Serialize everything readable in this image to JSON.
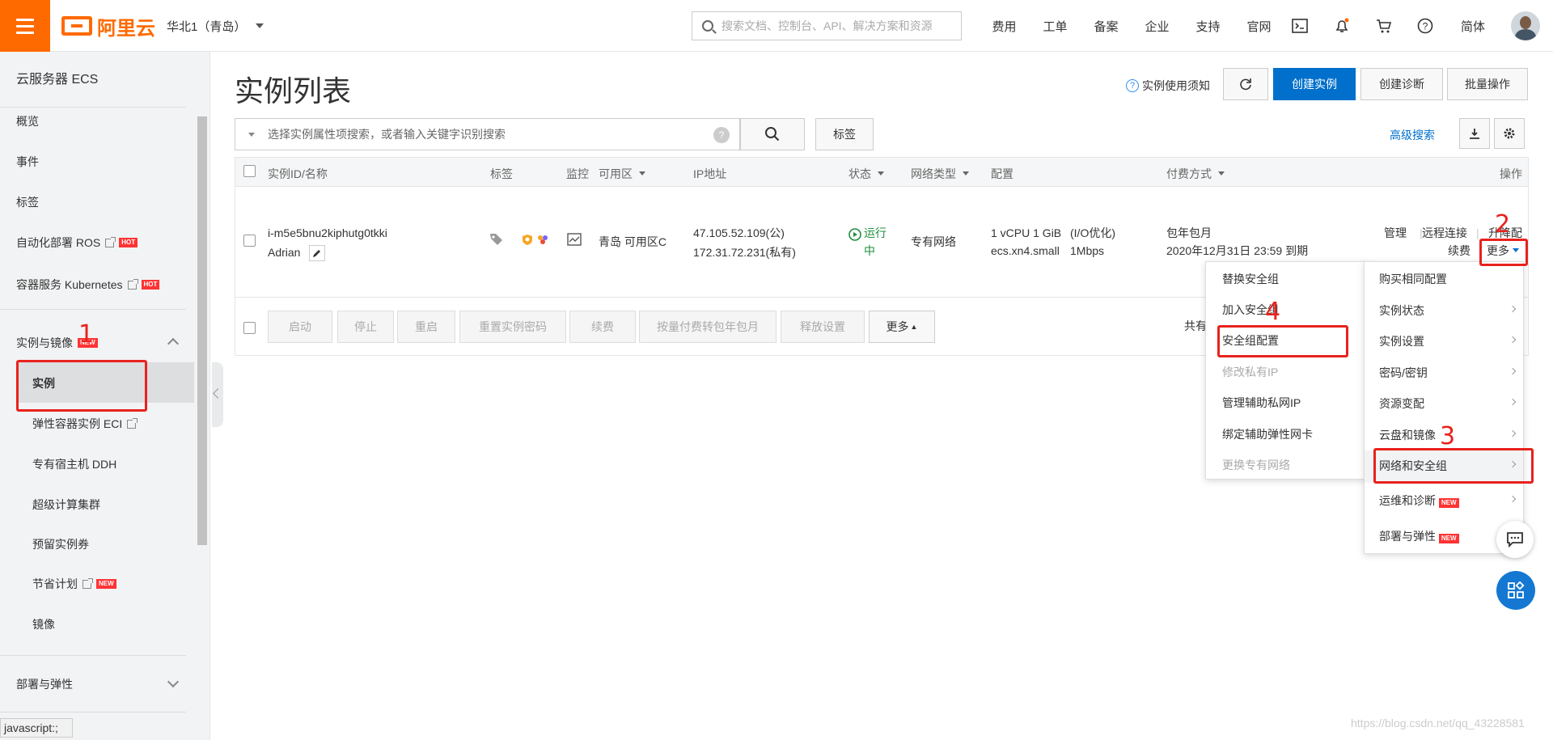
{
  "topbar": {
    "logo_text": "阿里云",
    "region": "华北1（青岛）",
    "search_placeholder": "搜索文档、控制台、API、解决方案和资源",
    "nav": [
      "费用",
      "工单",
      "备案",
      "企业",
      "支持",
      "官网"
    ],
    "lang": "简体",
    "icons": [
      "terminal-icon",
      "bell-icon",
      "cart-icon",
      "help-icon"
    ],
    "brand_color": "#ff6a00"
  },
  "sidebar": {
    "title": "云服务器 ECS",
    "items": [
      {
        "label": "概览"
      },
      {
        "label": "事件"
      },
      {
        "label": "标签"
      },
      {
        "label": "自动化部署 ROS",
        "badge": "HOT"
      },
      {
        "label": "容器服务 Kubernetes",
        "badge": "HOT"
      }
    ],
    "group": {
      "label": "实例与镜像",
      "badge": "NEW"
    },
    "sub_items": [
      {
        "label": "实例"
      },
      {
        "label": "弹性容器实例 ECI"
      },
      {
        "label": "专有宿主机 DDH"
      },
      {
        "label": "超级计算集群"
      },
      {
        "label": "预留实例券"
      },
      {
        "label": "节省计划",
        "badge": "NEW"
      },
      {
        "label": "镜像"
      }
    ],
    "group2": {
      "label": "部署与弹性"
    },
    "status_tip": "javascript:;"
  },
  "main": {
    "title": "实例列表",
    "notice": "实例使用须知",
    "buttons": {
      "create": "创建实例",
      "diagnose": "创建诊断",
      "batch": "批量操作"
    },
    "filter_placeholder": "选择实例属性项搜索，或者输入关键字识别搜索",
    "tag_button": "标签",
    "advanced_search": "高级搜索",
    "columns": [
      "实例ID/名称",
      "标签",
      "监控",
      "可用区",
      "IP地址",
      "状态",
      "网络类型",
      "配置",
      "付费方式",
      "操作"
    ],
    "row": {
      "id": "i-m5e5bnu2kiphutg0tkki",
      "name": "Adrian",
      "zone": "青岛 可用区C",
      "ip_public": "47.105.52.109(公)",
      "ip_private": "172.31.72.231(私有)",
      "status": "运行中",
      "network": "专有网络",
      "config_line1": "1 vCPU 1 GiB",
      "config_io": "(I/O优化)",
      "config_type": "ecs.xn4.small",
      "config_bw": "1Mbps",
      "pay_type": "包年包月",
      "pay_expire": "2020年12月31日 23:59 到期",
      "ops": [
        "管理",
        "远程连接",
        "升降配",
        "续费",
        "更多"
      ]
    },
    "bulk_buttons": [
      "启动",
      "停止",
      "重启",
      "重置实例密码",
      "续费",
      "按量付费转包年包月",
      "释放设置",
      "更多"
    ],
    "total_prefix": "共有"
  },
  "more_menu": {
    "items": [
      "购买相同配置",
      "实例状态",
      "实例设置",
      "密码/密钥",
      "资源变配",
      "云盘和镜像",
      "网络和安全组",
      "运维和诊断",
      "部署与弹性"
    ],
    "new_badges": [
      "NEW",
      "NEW"
    ]
  },
  "sub_menu": {
    "items": [
      {
        "label": "替换安全组",
        "disabled": false
      },
      {
        "label": "加入安全组",
        "disabled": false
      },
      {
        "label": "安全组配置",
        "disabled": false
      },
      {
        "label": "修改私有IP",
        "disabled": true
      },
      {
        "label": "管理辅助私网IP",
        "disabled": false
      },
      {
        "label": "绑定辅助弹性网卡",
        "disabled": false
      },
      {
        "label": "更换专有网络",
        "disabled": true
      }
    ]
  },
  "annotations": [
    "1",
    "2",
    "3",
    "4"
  ],
  "watermark": "https://blog.csdn.net/qq_43228581",
  "annotation_color": "#e8221d",
  "link_color": "#0070cc"
}
